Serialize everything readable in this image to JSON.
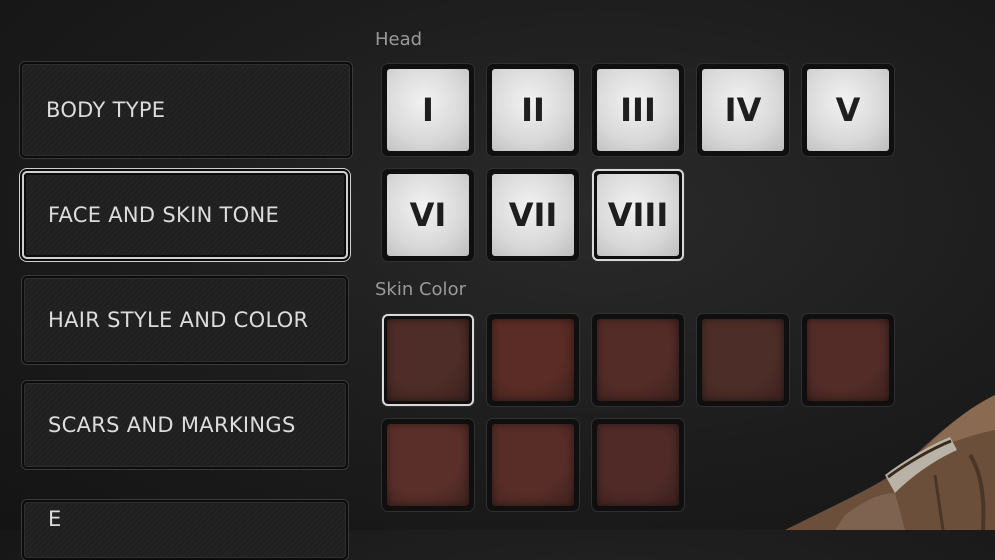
{
  "menu": {
    "items": [
      {
        "label": "BODY TYPE"
      },
      {
        "label": "FACE AND SKIN TONE"
      },
      {
        "label": "HAIR STYLE AND COLOR"
      },
      {
        "label": "SCARS AND MARKINGS"
      },
      {
        "label": "E"
      }
    ],
    "selected_index": 1
  },
  "head": {
    "label": "Head",
    "options": [
      "I",
      "II",
      "III",
      "IV",
      "V",
      "VI",
      "VII",
      "VIII"
    ],
    "selected": "VIII"
  },
  "skin": {
    "label": "Skin Color",
    "swatches": [
      "#4e2c27",
      "#5a2c25",
      "#532b27",
      "#4d2d28",
      "#532c28",
      "#5a2f2a",
      "#582d28",
      "#4f2a27"
    ],
    "selected_index": 0
  }
}
